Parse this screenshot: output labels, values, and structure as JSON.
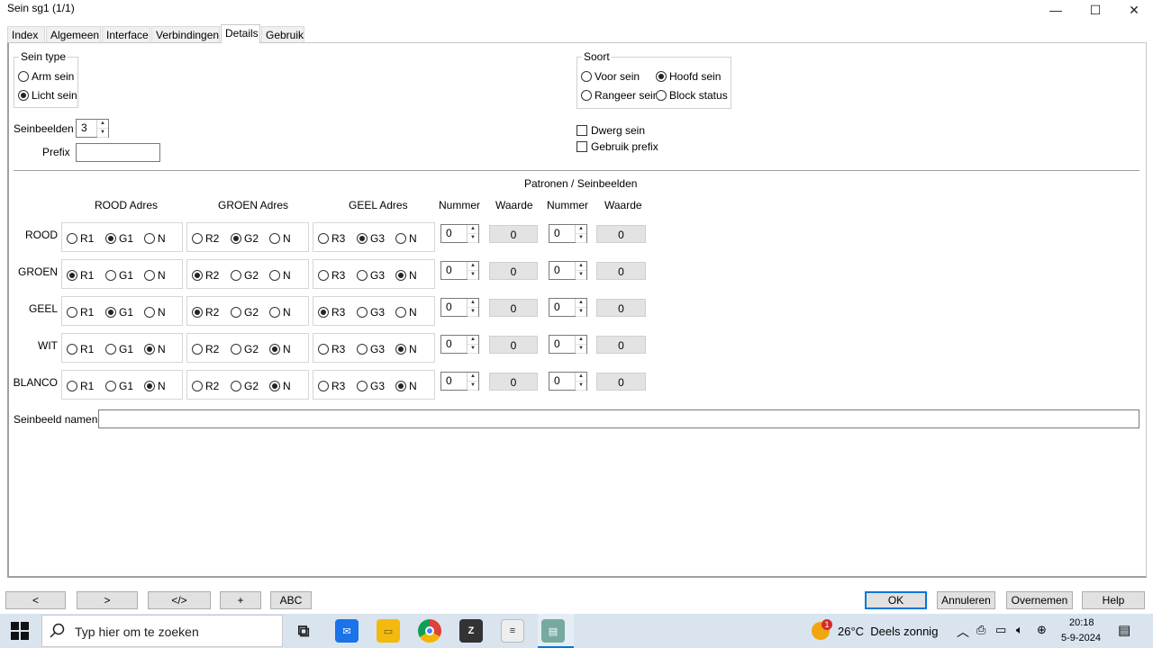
{
  "window": {
    "title": "Sein sg1 (1/1)",
    "min_glyph": "—",
    "max_glyph": "☐",
    "close_glyph": "✕"
  },
  "tabs": [
    "Index",
    "Algemeen",
    "Interface",
    "Verbindingen",
    "Details",
    "Gebruik"
  ],
  "active_tab": "Details",
  "sein_type": {
    "title": "Sein type",
    "options": [
      "Arm sein",
      "Licht sein"
    ],
    "selected": "Licht sein"
  },
  "soort": {
    "title": "Soort",
    "options": [
      "Voor sein",
      "Hoofd sein",
      "Rangeer sein",
      "Block status"
    ],
    "selected": "Hoofd sein"
  },
  "seinbeelden": {
    "label": "Seinbeelden",
    "value": "3"
  },
  "prefix": {
    "label": "Prefix",
    "value": ""
  },
  "checkboxes": [
    {
      "label": "Dwerg sein",
      "checked": false
    },
    {
      "label": "Gebruik prefix",
      "checked": false
    }
  ],
  "patronen": {
    "title": "Patronen / Seinbeelden",
    "headers": {
      "rood": "ROOD Adres",
      "groen": "GROEN Adres",
      "geel": "GEEL Adres",
      "nummer1": "Nummer",
      "waarde1": "Waarde",
      "nummer2": "Nummer",
      "waarde2": "Waarde"
    },
    "rows": [
      {
        "label": "ROOD",
        "rood": [
          "R1",
          "G1",
          "N"
        ],
        "rood_sel": 1,
        "groen": [
          "R2",
          "G2",
          "N"
        ],
        "groen_sel": 1,
        "geel": [
          "R3",
          "G3",
          "N"
        ],
        "geel_sel": 1,
        "nummer1": "0",
        "waarde1": "0",
        "nummer2": "0",
        "waarde2": "0"
      },
      {
        "label": "GROEN",
        "rood": [
          "R1",
          "G1",
          "N"
        ],
        "rood_sel": 0,
        "groen": [
          "R2",
          "G2",
          "N"
        ],
        "groen_sel": 0,
        "geel": [
          "R3",
          "G3",
          "N"
        ],
        "geel_sel": 2,
        "nummer1": "0",
        "waarde1": "0",
        "nummer2": "0",
        "waarde2": "0"
      },
      {
        "label": "GEEL",
        "rood": [
          "R1",
          "G1",
          "N"
        ],
        "rood_sel": 1,
        "groen": [
          "R2",
          "G2",
          "N"
        ],
        "groen_sel": 0,
        "geel": [
          "R3",
          "G3",
          "N"
        ],
        "geel_sel": 0,
        "nummer1": "0",
        "waarde1": "0",
        "nummer2": "0",
        "waarde2": "0"
      },
      {
        "label": "WIT",
        "rood": [
          "R1",
          "G1",
          "N"
        ],
        "rood_sel": 2,
        "groen": [
          "R2",
          "G2",
          "N"
        ],
        "groen_sel": 2,
        "geel": [
          "R3",
          "G3",
          "N"
        ],
        "geel_sel": 2,
        "nummer1": "0",
        "waarde1": "0",
        "nummer2": "0",
        "waarde2": "0"
      },
      {
        "label": "BLANCO",
        "rood": [
          "R1",
          "G1",
          "N"
        ],
        "rood_sel": 2,
        "groen": [
          "R2",
          "G2",
          "N"
        ],
        "groen_sel": 2,
        "geel": [
          "R3",
          "G3",
          "N"
        ],
        "geel_sel": 2,
        "nummer1": "0",
        "waarde1": "0",
        "nummer2": "0",
        "waarde2": "0"
      }
    ]
  },
  "seinbeeld_namen": {
    "label": "Seinbeeld namen",
    "value": ""
  },
  "bottom_left_buttons": [
    "<",
    ">",
    "</>",
    "+",
    "ABC"
  ],
  "bottom_right_buttons": [
    "OK",
    "Annuleren",
    "Overnemen",
    "Help"
  ],
  "taskbar": {
    "search_placeholder": "Typ hier om te zoeken",
    "weather": "26°C  Deels zonnig",
    "time": "20:18",
    "date": "5-9-2024",
    "notification_badge": "1",
    "colors": {
      "taskbar_bg": "#d9e4ef",
      "accent": "#0078d7"
    }
  }
}
